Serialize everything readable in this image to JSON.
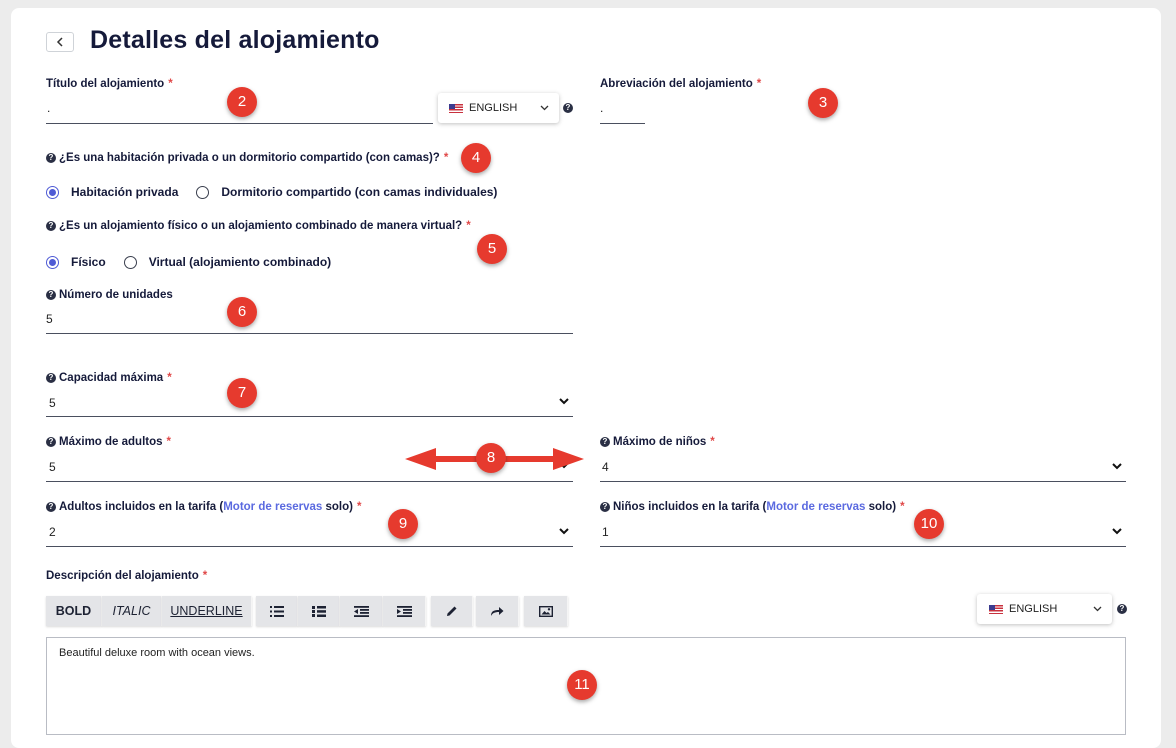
{
  "header": {
    "title": "Detalles del alojamiento",
    "back_icon": "chevron-left-icon"
  },
  "title_field": {
    "label": "Título del alojamiento",
    "value": ".",
    "language": "ENGLISH"
  },
  "abbrev_field": {
    "label": "Abreviación del alojamiento",
    "value": "."
  },
  "room_type": {
    "question": "¿Es una habitación privada o un dormitorio compartido (con camas)?",
    "options": [
      "Habitación privada",
      "Dormitorio compartido (con camas individuales)"
    ],
    "selected": "Habitación privada"
  },
  "physical_type": {
    "question": "¿Es un alojamiento físico o un alojamiento combinado de manera virtual?",
    "options": [
      "Físico",
      "Virtual (alojamiento combinado)"
    ],
    "selected": "Físico"
  },
  "units": {
    "label": "Número de unidades",
    "value": "5"
  },
  "max_capacity": {
    "label": "Capacidad máxima",
    "value": "5"
  },
  "max_adults": {
    "label": "Máximo de adultos",
    "value": "5"
  },
  "max_children": {
    "label": "Máximo de niños",
    "value": "4"
  },
  "adults_included": {
    "label_before": "Adultos incluidos en la tarifa (",
    "link": "Motor de reservas",
    "label_after": " solo)",
    "value": "2"
  },
  "children_included": {
    "label_before": "Niños incluidos en la tarifa (",
    "link": "Motor de reservas",
    "label_after": " solo)",
    "value": "1"
  },
  "description": {
    "label": "Descripción del alojamiento",
    "toolbar": {
      "bold": "BOLD",
      "italic": "ITALIC",
      "underline": "UNDERLINE"
    },
    "language": "ENGLISH",
    "text": "Beautiful deluxe room with ocean views."
  },
  "required_mark": "*",
  "help_mark": "?",
  "markers": [
    "2",
    "3",
    "4",
    "5",
    "6",
    "7",
    "8",
    "9",
    "10",
    "11"
  ],
  "colors": {
    "accent": "#4f5bd5",
    "marker": "#e63a2e",
    "required": "#e04848",
    "title": "#151a3a"
  }
}
